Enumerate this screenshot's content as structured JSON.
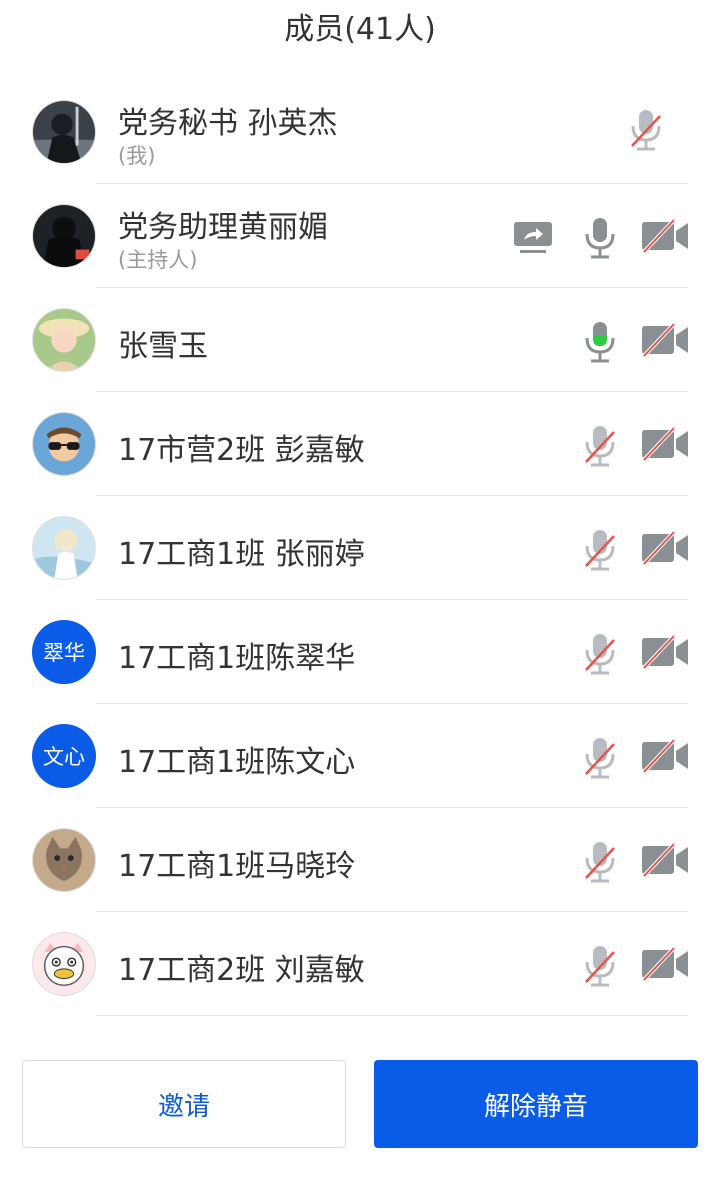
{
  "header": {
    "title": "成员(41人)"
  },
  "members": [
    {
      "name": "党务秘书 孙英杰",
      "sub": "(我)",
      "avatar": "photo",
      "sharing": false,
      "mic": "muted",
      "camera": "none"
    },
    {
      "name": "党务助理黄丽媚",
      "sub": "(主持人)",
      "avatar": "photo",
      "sharing": true,
      "mic": "on",
      "camera": "off"
    },
    {
      "name": "张雪玉",
      "sub": "",
      "avatar": "photo",
      "sharing": false,
      "mic": "speaking",
      "camera": "off"
    },
    {
      "name": " 17市营2班 彭嘉敏",
      "sub": "",
      "avatar": "photo",
      "sharing": false,
      "mic": "muted",
      "camera": "off"
    },
    {
      "name": "17工商1班 张丽婷",
      "sub": "",
      "avatar": "photo",
      "sharing": false,
      "mic": "muted",
      "camera": "off"
    },
    {
      "name": "17工商1班陈翠华",
      "sub": "",
      "avatar": "text",
      "avatar_text": "翠华",
      "sharing": false,
      "mic": "muted",
      "camera": "off"
    },
    {
      "name": "17工商1班陈文心",
      "sub": "",
      "avatar": "text",
      "avatar_text": "文心",
      "sharing": false,
      "mic": "muted",
      "camera": "off"
    },
    {
      "name": "17工商1班马晓玲",
      "sub": "",
      "avatar": "photo",
      "sharing": false,
      "mic": "muted",
      "camera": "off"
    },
    {
      "name": "17工商2班 刘嘉敏",
      "sub": "",
      "avatar": "photo",
      "sharing": false,
      "mic": "muted",
      "camera": "off"
    }
  ],
  "footer": {
    "invite_label": "邀请",
    "unmute_all_label": "解除静音"
  },
  "colors": {
    "accent": "#0a5be8",
    "speaking": "#2ecc40",
    "muted_slash": "#e5534b",
    "icon_gray": "#8a8f94"
  }
}
